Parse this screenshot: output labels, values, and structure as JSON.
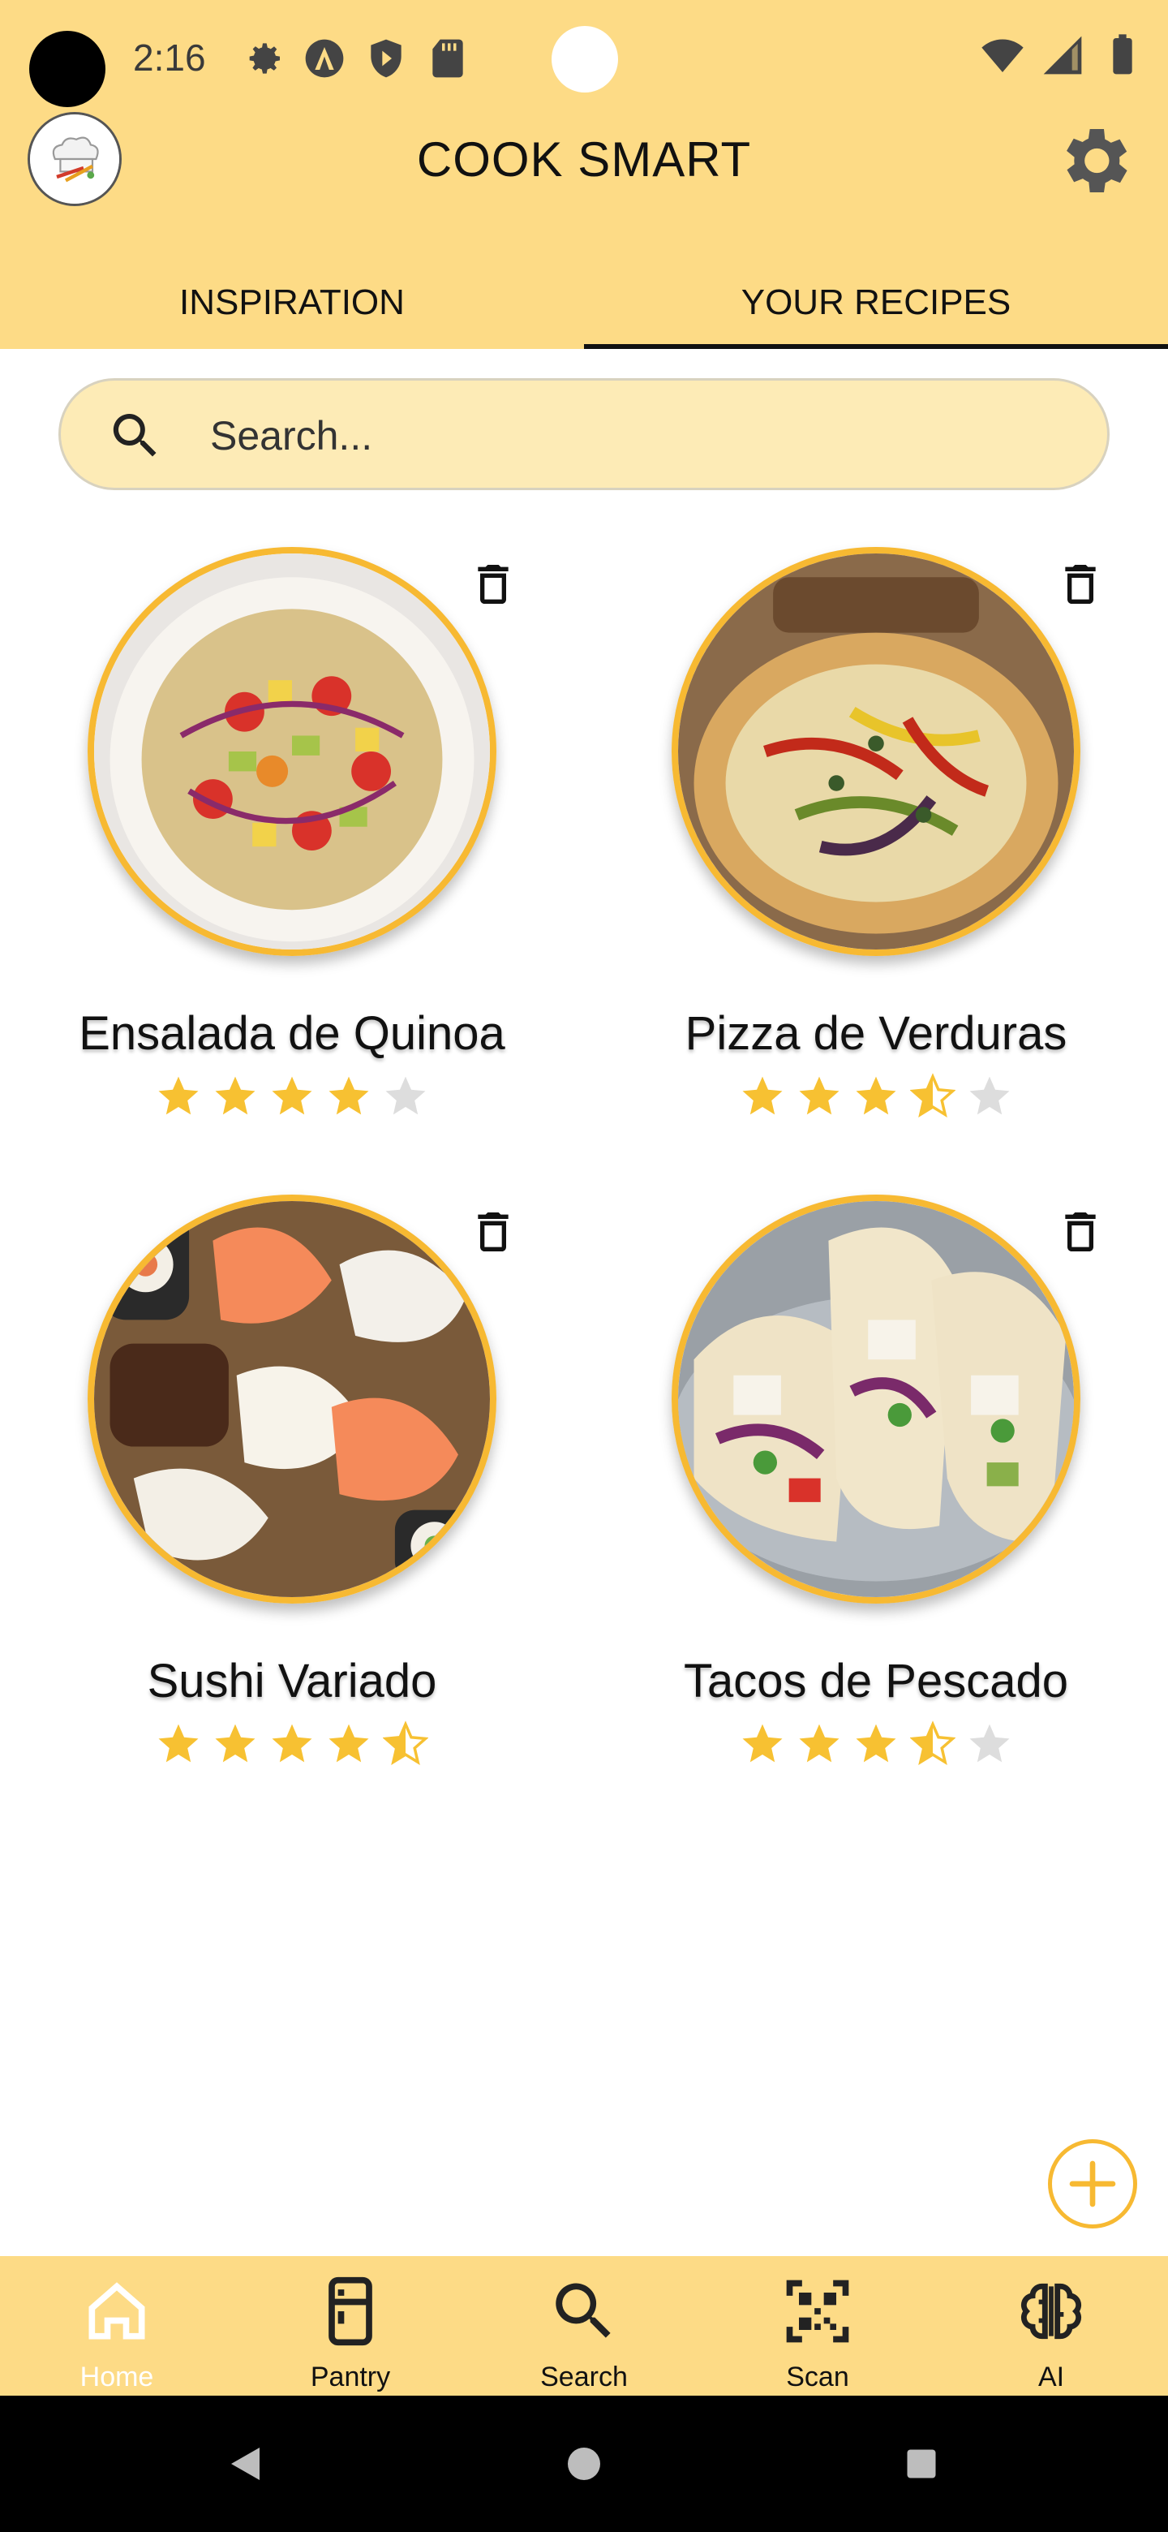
{
  "status_bar": {
    "time": "2:16"
  },
  "header": {
    "title": "COOK SMART"
  },
  "tabs": [
    {
      "label": "INSPIRATION",
      "active": false
    },
    {
      "label": "YOUR RECIPES",
      "active": true
    }
  ],
  "search": {
    "placeholder": "Search...",
    "value": ""
  },
  "recipes": [
    {
      "name": "Ensalada de Quinoa",
      "rating": 4
    },
    {
      "name": "Pizza de Verduras",
      "rating": 3.5
    },
    {
      "name": "Sushi Variado",
      "rating": 4.5
    },
    {
      "name": "Tacos de Pescado",
      "rating": 3.5
    }
  ],
  "bottom_nav": [
    {
      "label": "Home",
      "icon": "home-icon",
      "active": true
    },
    {
      "label": "Pantry",
      "icon": "fridge-icon",
      "active": false
    },
    {
      "label": "Search",
      "icon": "search-icon",
      "active": false
    },
    {
      "label": "Scan",
      "icon": "qr-scan-icon",
      "active": false
    },
    {
      "label": "AI",
      "icon": "brain-icon",
      "active": false
    }
  ],
  "colors": {
    "accent": "#FDDB86",
    "ring": "#F7B932",
    "star": "#F7C132",
    "star_empty": "#DDDDDD"
  }
}
